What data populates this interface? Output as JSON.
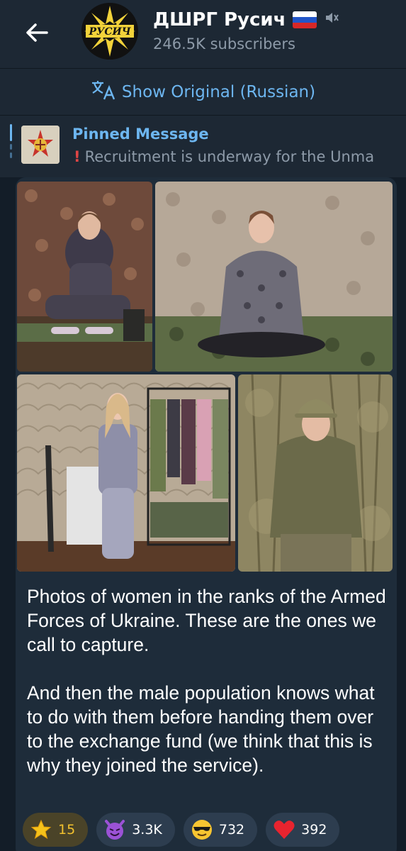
{
  "header": {
    "channel_name": "ДШРГ Русич",
    "subscribers": "246.5K subscribers",
    "avatar_text": "РУСИЧ"
  },
  "translate": {
    "label": "Show Original (Russian)"
  },
  "pinned": {
    "title": "Pinned Message",
    "text": "Recruitment is underway for the Unma"
  },
  "message": {
    "caption_paragraphs": [
      "Photos of women in the ranks of the Armed Forces of Ukraine. These are the ones we call to capture.",
      "And then the male population knows what to do with them before handing them over to the exchange fund (we think that this is why they joined the service)."
    ],
    "reactions": [
      {
        "icon": "star-icon",
        "count": "15"
      },
      {
        "icon": "smiling-devil-icon",
        "count": "3.3K"
      },
      {
        "icon": "sunglasses-face-icon",
        "count": "732"
      },
      {
        "icon": "heart-icon",
        "count": "392"
      }
    ]
  },
  "colors": {
    "accent": "#6db6f0",
    "background": "#131d28",
    "bubble": "#1e2c3a"
  }
}
